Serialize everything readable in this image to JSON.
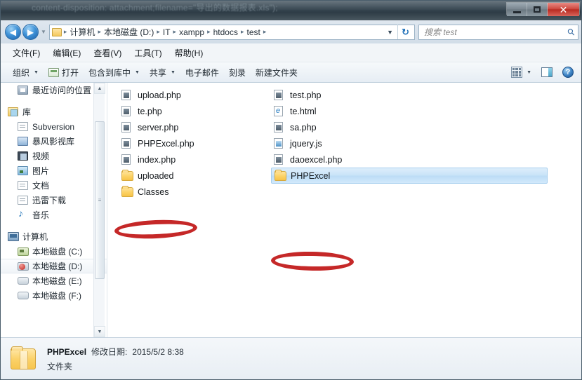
{
  "window": {
    "title_ghost": "content-disposition: attachment;filename=\"导出的数据报表.xls\");",
    "controls": {
      "minimize": "minimize-button",
      "maximize": "maximize-button",
      "close": "✕"
    }
  },
  "address": {
    "back": "◀",
    "forward": "▶",
    "history_caret": "▼",
    "crumbs": [
      "计算机",
      "本地磁盘 (D:)",
      "IT",
      "xampp",
      "htdocs",
      "test"
    ],
    "separator": "▸",
    "dropdown_caret": "▼",
    "refresh": "↻"
  },
  "search": {
    "placeholder": "搜索 test",
    "icon": "search-icon"
  },
  "menu": {
    "items": [
      {
        "label": "文件(F)"
      },
      {
        "label": "编辑(E)"
      },
      {
        "label": "查看(V)"
      },
      {
        "label": "工具(T)"
      },
      {
        "label": "帮助(H)"
      }
    ]
  },
  "toolbar": {
    "organize": "组织",
    "open": "打开",
    "include_in_library": "包含到库中",
    "share": "共享",
    "email": "电子邮件",
    "burn": "刻录",
    "new_folder": "新建文件夹",
    "caret": "▼",
    "help": "?"
  },
  "sidebar": {
    "items": [
      {
        "label": "最近访问的位置",
        "icon": "recent-places-icon",
        "level": "indent",
        "selected": false
      },
      {
        "label": "库",
        "icon": "library-icon",
        "level": "header",
        "selected": false
      },
      {
        "label": "Subversion",
        "icon": "document-icon",
        "level": "indent",
        "selected": false
      },
      {
        "label": "暴风影视库",
        "icon": "video-library-icon",
        "level": "indent",
        "selected": false
      },
      {
        "label": "视频",
        "icon": "film-icon",
        "level": "indent",
        "selected": false
      },
      {
        "label": "图片",
        "icon": "picture-icon",
        "level": "indent",
        "selected": false
      },
      {
        "label": "文档",
        "icon": "document-icon",
        "level": "indent",
        "selected": false
      },
      {
        "label": "迅雷下载",
        "icon": "document-icon",
        "level": "indent",
        "selected": false
      },
      {
        "label": "音乐",
        "icon": "music-icon",
        "level": "indent",
        "selected": false
      },
      {
        "label": "计算机",
        "icon": "computer-icon",
        "level": "header",
        "selected": false
      },
      {
        "label": "本地磁盘 (C:)",
        "icon": "drive-system-icon",
        "level": "indent",
        "selected": false
      },
      {
        "label": "本地磁盘 (D:)",
        "icon": "drive-full-icon",
        "level": "indent",
        "selected": true
      },
      {
        "label": "本地磁盘 (E:)",
        "icon": "drive-icon",
        "level": "indent",
        "selected": false
      },
      {
        "label": "本地磁盘 (F:)",
        "icon": "drive-icon",
        "level": "indent",
        "selected": false
      }
    ],
    "scroll_up": "▲",
    "scroll_down": "▼",
    "grip": "≡"
  },
  "files": {
    "column1": [
      {
        "name": "upload.php",
        "type": "php",
        "selected": false,
        "circled": false
      },
      {
        "name": "te.php",
        "type": "php",
        "selected": false,
        "circled": false
      },
      {
        "name": "server.php",
        "type": "php",
        "selected": false,
        "circled": false
      },
      {
        "name": "PHPExcel.php",
        "type": "php",
        "selected": false,
        "circled": true
      },
      {
        "name": "index.php",
        "type": "php",
        "selected": false,
        "circled": false
      },
      {
        "name": "uploaded",
        "type": "folder",
        "selected": false,
        "circled": false
      },
      {
        "name": "Classes",
        "type": "folder",
        "selected": false,
        "circled": false
      }
    ],
    "column2": [
      {
        "name": "test.php",
        "type": "php",
        "selected": false,
        "circled": false
      },
      {
        "name": "te.html",
        "type": "html",
        "selected": false,
        "circled": false
      },
      {
        "name": "sa.php",
        "type": "php",
        "selected": false,
        "circled": false
      },
      {
        "name": "jquery.js",
        "type": "js",
        "selected": false,
        "circled": false
      },
      {
        "name": "daoexcel.php",
        "type": "php",
        "selected": false,
        "circled": false
      },
      {
        "name": "PHPExcel",
        "type": "folder",
        "selected": true,
        "circled": true
      }
    ]
  },
  "status": {
    "name": "PHPExcel",
    "modified_label": "修改日期:",
    "modified_value": "2015/5/2 8:38",
    "item_type": "文件夹"
  },
  "colors": {
    "accent": "#c9e3f8",
    "marker_red": "#c01616",
    "folder_yellow": "#fbd26a",
    "close_red": "#cf4b42"
  }
}
